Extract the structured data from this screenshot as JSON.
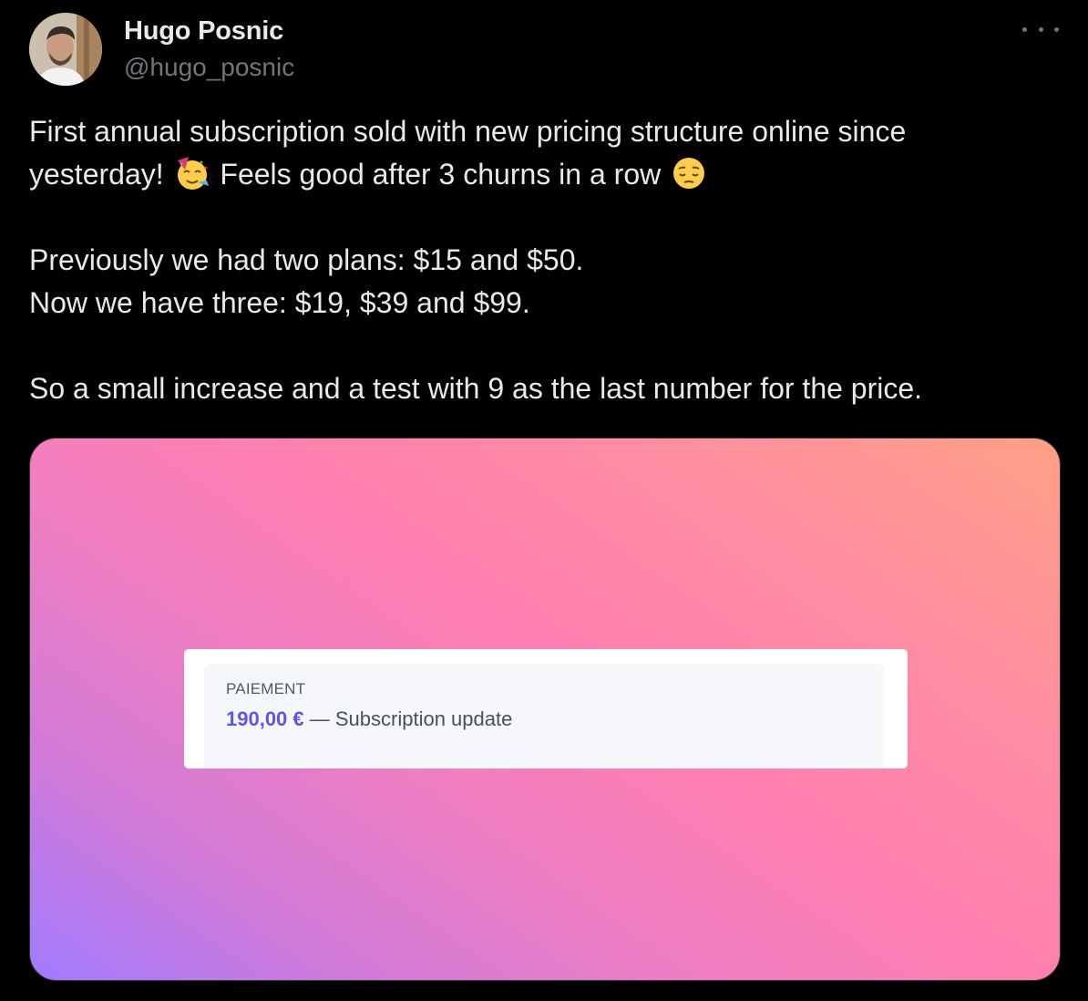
{
  "author": {
    "display_name": "Hugo Posnic",
    "handle": "@hugo_posnic"
  },
  "more_icon": "more-horizontal-icon",
  "tweet": {
    "line1a": "First annual subscription sold with new pricing structure online since",
    "line1b_pre": "yesterday!",
    "emoji1": "partying-face-emoji",
    "line1b_mid": "Feels good after 3 churns in a row",
    "emoji2": "pensive-face-emoji",
    "line2": "Previously we had two plans: $15 and $50.",
    "line3": "Now we have three: $19, $39 and $99.",
    "line4": "So a small increase and a test with 9 as the last number for the price."
  },
  "media": {
    "label": "PAIEMENT",
    "amount": "190,00 €",
    "separator": " — ",
    "description": "Subscription update",
    "colors": {
      "gradient_start": "#a17bff",
      "gradient_mid": "#ff7fb0",
      "gradient_end": "#ffa086",
      "amount": "#5a57e4"
    }
  }
}
